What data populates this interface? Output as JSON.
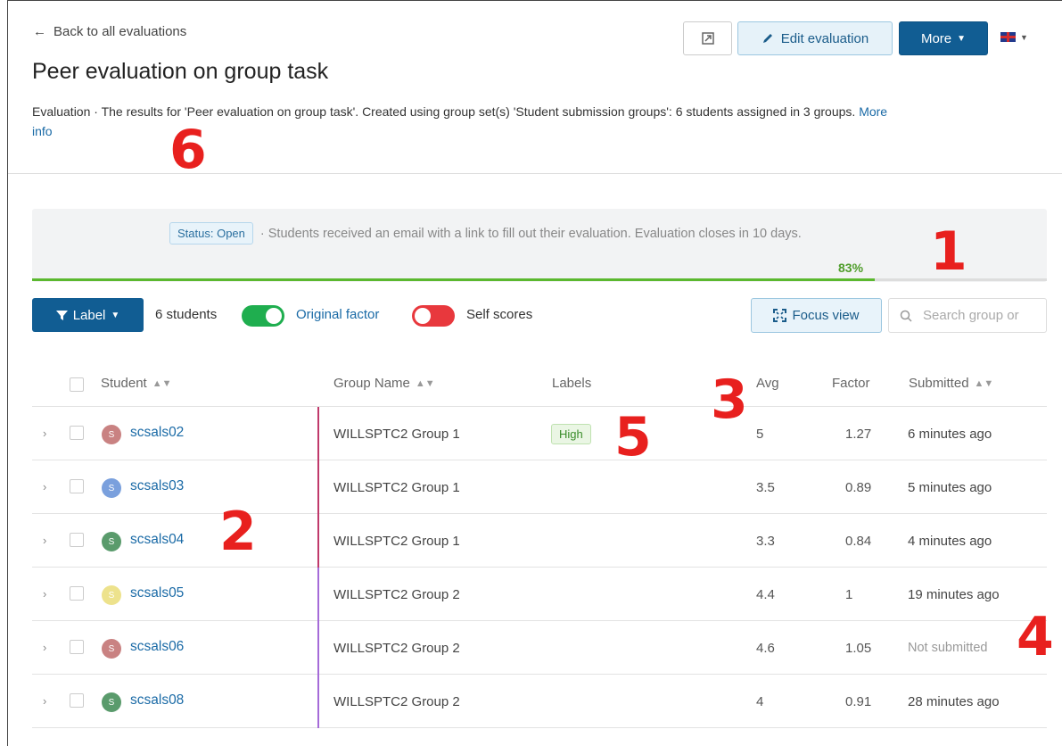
{
  "header": {
    "back_label": "Back to all evaluations",
    "title": "Peer evaluation on group task",
    "description": "Evaluation · The results for 'Peer evaluation on group task'. Created using group set(s) 'Student submission groups': 6 students assigned in 3 groups.",
    "more_info_link": "More info",
    "edit_button": "Edit evaluation",
    "more_button": "More",
    "language_icon": "uk-flag-icon"
  },
  "status": {
    "badge": "Status: Open",
    "message": "· Students received an email with a link to fill out their evaluation. Evaluation closes in 10 days.",
    "progress_percent": 83,
    "progress_label": "83%",
    "progress_color": "#5bb82f"
  },
  "toolbar": {
    "label_button": "Label",
    "student_count": "6 students",
    "original_factor": {
      "label": "Original factor",
      "on": true
    },
    "self_scores": {
      "label": "Self scores",
      "on": false
    },
    "focus_view": "Focus view",
    "search_placeholder": "Search group or"
  },
  "table": {
    "columns": {
      "student": "Student",
      "group": "Group Name",
      "labels": "Labels",
      "avg": "Avg",
      "factor": "Factor",
      "submitted": "Submitted"
    },
    "rows": [
      {
        "initial": "S",
        "avatar_color": "#c98282",
        "student": "scsals02",
        "group": "WILLSPTC2 Group 1",
        "group_color": "#c0396b",
        "label": "High",
        "avg": "5",
        "factor": "1.27",
        "submitted": "6 minutes ago",
        "submitted_state": "yes"
      },
      {
        "initial": "S",
        "avatar_color": "#7aa0dd",
        "student": "scsals03",
        "group": "WILLSPTC2 Group 1",
        "group_color": "#c0396b",
        "label": "",
        "avg": "3.5",
        "factor": "0.89",
        "submitted": "5 minutes ago",
        "submitted_state": "yes"
      },
      {
        "initial": "S",
        "avatar_color": "#5a9b6c",
        "student": "scsals04",
        "group": "WILLSPTC2 Group 1",
        "group_color": "#c0396b",
        "label": "",
        "avg": "3.3",
        "factor": "0.84",
        "submitted": "4 minutes ago",
        "submitted_state": "yes"
      },
      {
        "initial": "S",
        "avatar_color": "#ede28c",
        "student": "scsals05",
        "group": "WILLSPTC2 Group 2",
        "group_color": "#a56bd8",
        "label": "",
        "avg": "4.4",
        "factor": "1",
        "submitted": "19 minutes ago",
        "submitted_state": "yes"
      },
      {
        "initial": "S",
        "avatar_color": "#c98282",
        "student": "scsals06",
        "group": "WILLSPTC2 Group 2",
        "group_color": "#a56bd8",
        "label": "",
        "avg": "4.6",
        "factor": "1.05",
        "submitted": "Not submitted",
        "submitted_state": "no"
      },
      {
        "initial": "S",
        "avatar_color": "#5a9b6c",
        "student": "scsals08",
        "group": "WILLSPTC2 Group 2",
        "group_color": "#a56bd8",
        "label": "",
        "avg": "4",
        "factor": "0.91",
        "submitted": "28 minutes ago",
        "submitted_state": "yes"
      }
    ]
  },
  "annotations": [
    "1",
    "2",
    "3",
    "4",
    "5",
    "6"
  ]
}
